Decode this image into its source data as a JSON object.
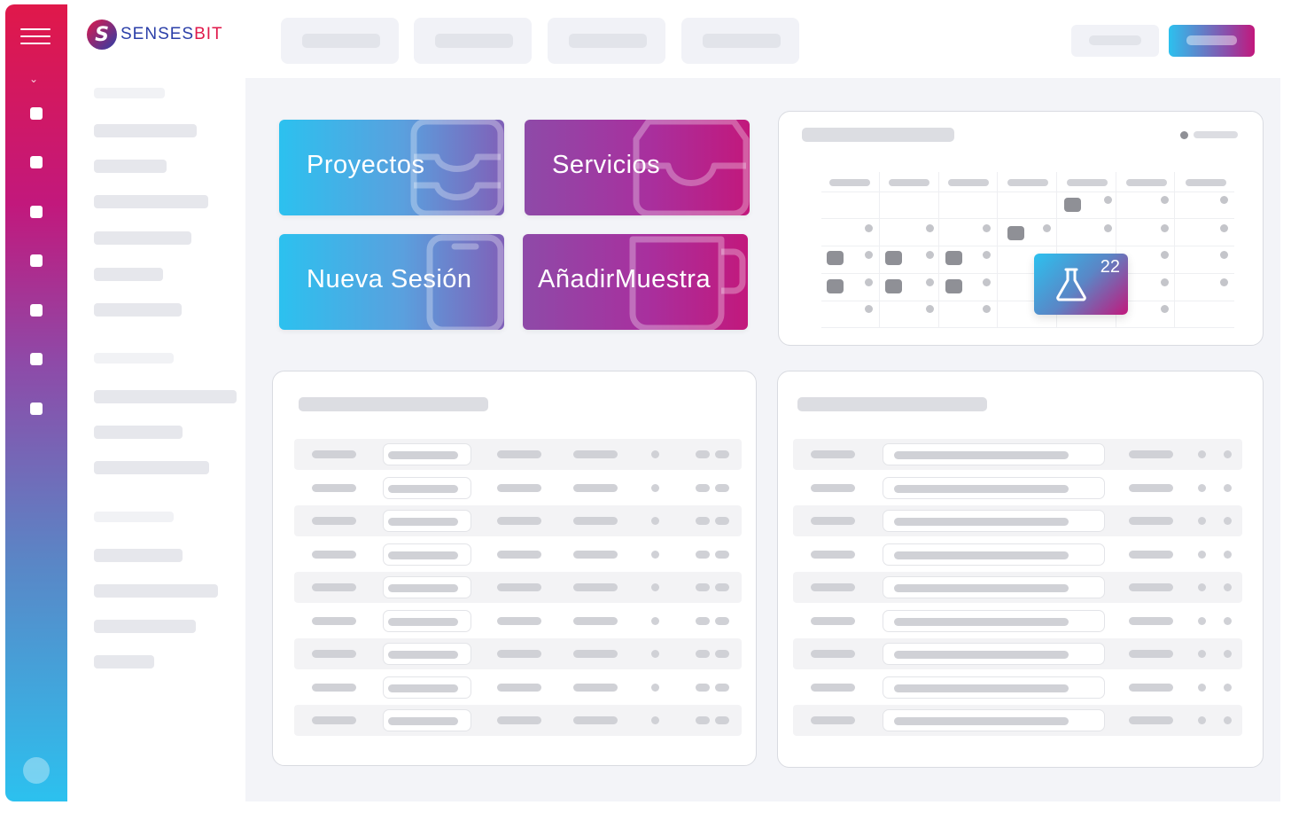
{
  "brand": {
    "name_part1": "SENSES",
    "name_part2": "BIT",
    "mark": "S"
  },
  "tiles": [
    {
      "label": "Proyectos",
      "style": "blue",
      "icon": "archive-tray-icon"
    },
    {
      "label": "Servicios",
      "style": "purple",
      "icon": "tray-icon"
    },
    {
      "label": "Nueva Sesión",
      "style": "blue",
      "icon": "tablet-icon"
    },
    {
      "label": "AñadirMuestra",
      "style": "purple",
      "icon": "mug-icon"
    }
  ],
  "calendar": {
    "event_count": "22",
    "event_icon": "flask-icon"
  },
  "colors": {
    "rail_top": "#e0184a",
    "rail_mid": "#8e4aa8",
    "rail_bottom": "#2cc1ef",
    "blue_tile": "#2cc1ef",
    "purple_tile": "#c2187c"
  }
}
